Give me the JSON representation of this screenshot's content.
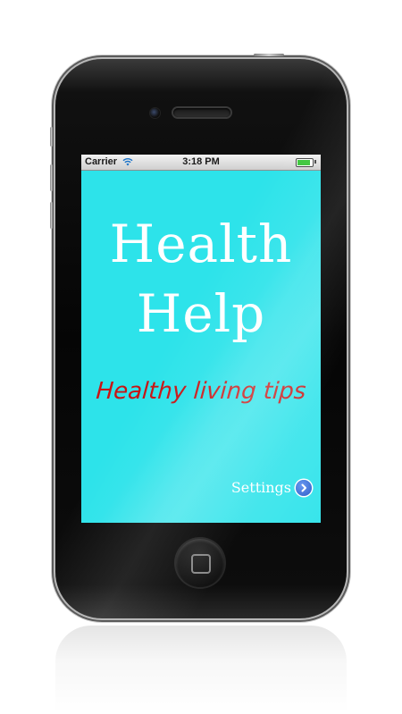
{
  "status_bar": {
    "carrier": "Carrier",
    "time": "3:18 PM",
    "wifi_icon": "wifi-icon",
    "battery_icon": "battery-icon",
    "battery_color": "#3cc63c"
  },
  "app": {
    "title_line1": "Health",
    "title_line2": "Help",
    "tagline": "Healthy living tips",
    "settings_label": "Settings",
    "settings_icon": "chevron-right-icon"
  },
  "colors": {
    "screen_background": "#2de3ea",
    "title_color": "#ffffff",
    "tagline_color": "#c81414",
    "settings_icon_color": "#1d4fc2"
  }
}
